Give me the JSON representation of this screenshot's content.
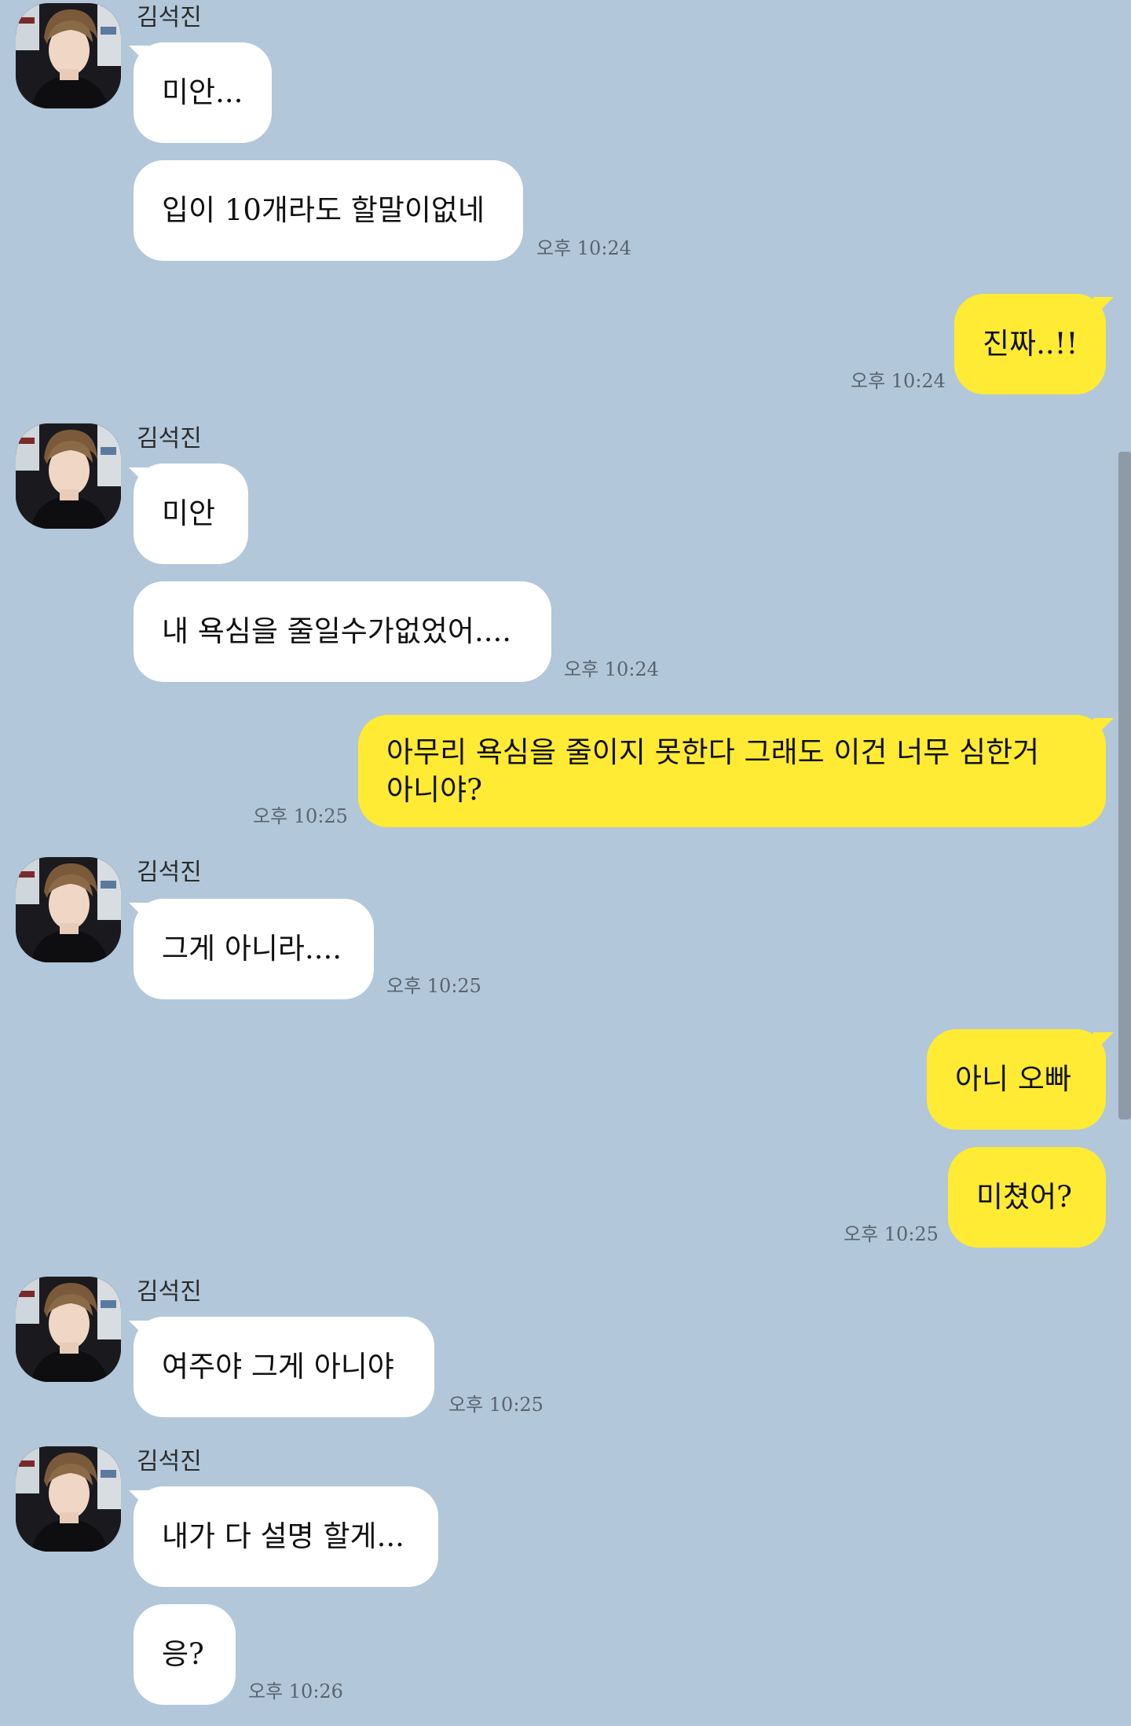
{
  "contact": {
    "name": "김석진"
  },
  "colors": {
    "background": "#b2c7d9",
    "incoming_bubble": "#ffffff",
    "outgoing_bubble": "#ffeb33"
  },
  "messages": [
    {
      "from": "other",
      "text": "미안...",
      "show_sender": true
    },
    {
      "from": "other",
      "text": "입이 10개라도 할말이없네",
      "time": "오후 10:24"
    },
    {
      "from": "me",
      "text": "진짜..!!",
      "time": "오후 10:24"
    },
    {
      "from": "other",
      "text": "미안",
      "show_sender": true
    },
    {
      "from": "other",
      "text": "내 욕심을 줄일수가없었어....",
      "time": "오후 10:24"
    },
    {
      "from": "me",
      "text": "아무리 욕심을 줄이지 못한다 그래도 이건 너무 심한거 아니야?",
      "time": "오후 10:25"
    },
    {
      "from": "other",
      "text": "그게 아니라....",
      "time": "오후 10:25",
      "show_sender": true
    },
    {
      "from": "me",
      "text": "아니 오빠"
    },
    {
      "from": "me",
      "text": "미쳤어?",
      "time": "오후 10:25"
    },
    {
      "from": "other",
      "text": "여주야 그게 아니야",
      "time": "오후 10:25",
      "show_sender": true
    },
    {
      "from": "other",
      "text": "내가 다 설명 할게...",
      "show_sender": true
    },
    {
      "from": "other",
      "text": "응?",
      "time": "오후 10:26"
    }
  ]
}
